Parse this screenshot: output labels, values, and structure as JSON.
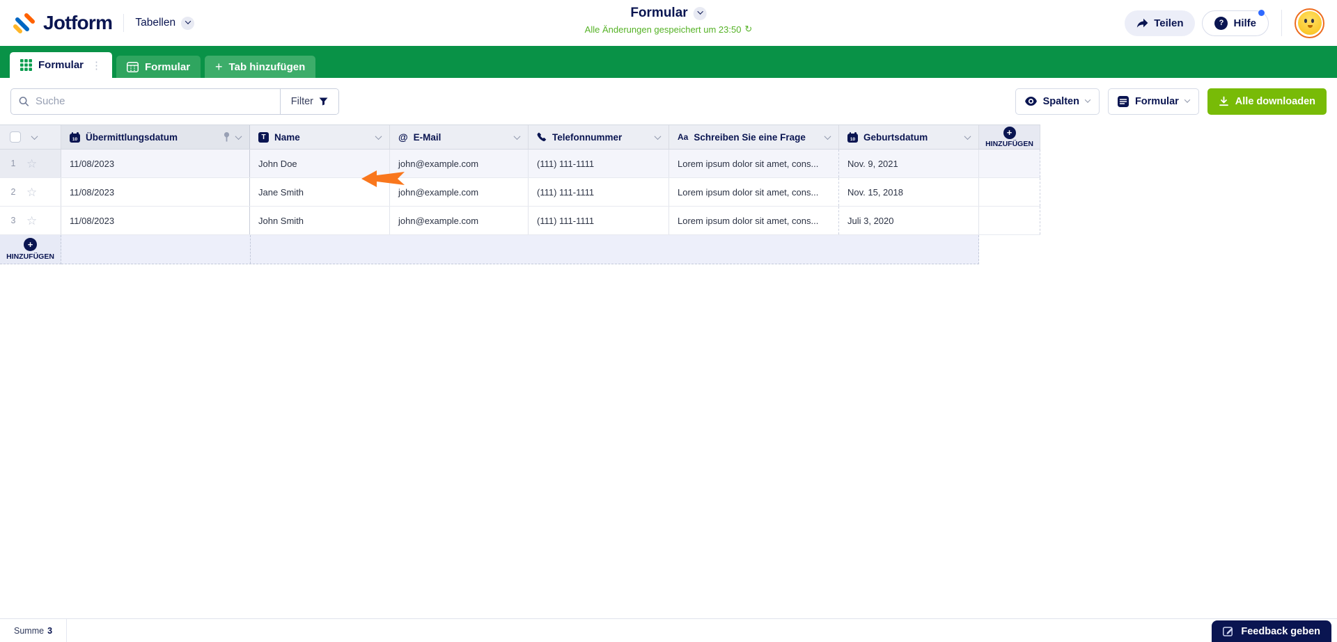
{
  "topbar": {
    "logo_text": "Jotform",
    "product_label": "Tabellen",
    "title": "Formular",
    "save_status": "Alle Änderungen gespeichert um 23:50",
    "share_label": "Teilen",
    "help_label": "Hilfe"
  },
  "tabbar": {
    "tabs": [
      {
        "label": "Formular",
        "active": true
      },
      {
        "label": "Formular",
        "active": false
      }
    ],
    "add_tab_label": "Tab hinzufügen"
  },
  "toolbar": {
    "search_placeholder": "Suche",
    "filter_label": "Filter",
    "columns_button": "Spalten",
    "view_button": "Formular",
    "download_button": "Alle downloaden"
  },
  "table": {
    "columns": [
      {
        "label": "Übermittlungsdatum",
        "icon": "calendar-icon",
        "pinned": true
      },
      {
        "label": "Name",
        "icon": "text-field-icon",
        "pinned": false
      },
      {
        "label": "E-Mail",
        "icon": "at-icon",
        "pinned": false
      },
      {
        "label": "Telefonnummer",
        "icon": "phone-icon",
        "pinned": false
      },
      {
        "label": "Schreiben Sie eine Frage",
        "icon": "textarea-icon",
        "pinned": false
      },
      {
        "label": "Geburtsdatum",
        "icon": "calendar-icon",
        "pinned": false
      }
    ],
    "add_column_label": "HINZUFÜGEN",
    "add_row_label": "HINZUFÜGEN",
    "rows": [
      {
        "num": "1",
        "cells": [
          "11/08/2023",
          "John Doe",
          "john@example.com",
          "(111) 111-1111",
          "Lorem ipsum dolor sit amet, cons...",
          "Nov. 9, 2021"
        ]
      },
      {
        "num": "2",
        "cells": [
          "11/08/2023",
          "Jane Smith",
          "john@example.com",
          "(111) 111-1111",
          "Lorem ipsum dolor sit amet, cons...",
          "Nov. 15, 2018"
        ]
      },
      {
        "num": "3",
        "cells": [
          "11/08/2023",
          "John Smith",
          "john@example.com",
          "(111) 111-1111",
          "Lorem ipsum dolor sit amet, cons...",
          "Juli 3, 2020"
        ]
      }
    ]
  },
  "footer": {
    "sum_label": "Summe",
    "sum_value": "3",
    "feedback_label": "Feedback geben"
  },
  "icons": {
    "text_field_glyph": "T",
    "email_glyph": "@",
    "textarea_glyph": "Aa",
    "calendar_day": "10",
    "tab_menu_glyph": "⋮",
    "plus_glyph": "+",
    "help_glyph": "?",
    "refresh_glyph": "↻",
    "star_glyph": "☆"
  },
  "colors": {
    "brand_navy": "#0a1551",
    "header_green": "#099247",
    "download_green": "#78bb07",
    "annotation_orange": "#f9771d",
    "saved_text_green": "#55b226"
  }
}
